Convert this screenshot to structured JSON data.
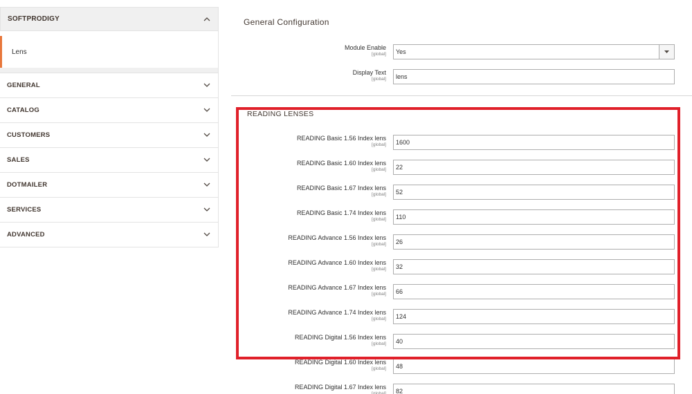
{
  "sidebar": {
    "group_title": "SOFTPRODIGY",
    "sub_item": "Lens",
    "sections": [
      "GENERAL",
      "CATALOG",
      "CUSTOMERS",
      "SALES",
      "DOTMAILER",
      "SERVICES",
      "ADVANCED"
    ]
  },
  "general": {
    "title": "General Configuration",
    "module_enable": {
      "label": "Module Enable",
      "scope": "[global]",
      "value": "Yes"
    },
    "display_text": {
      "label": "Display Text",
      "scope": "[global]",
      "value": "lens"
    }
  },
  "reading": {
    "title": "READING LENSES",
    "fields": [
      {
        "label": "READING Basic 1.56 Index lens",
        "scope": "[global]",
        "value": "1600"
      },
      {
        "label": "READING Basic 1.60 Index lens",
        "scope": "[global]",
        "value": "22"
      },
      {
        "label": "READING Basic 1.67 Index lens",
        "scope": "[global]",
        "value": "52"
      },
      {
        "label": "READING Basic 1.74 Index lens",
        "scope": "[global]",
        "value": "110"
      },
      {
        "label": "READING Advance 1.56 Index lens",
        "scope": "[global]",
        "value": "26"
      },
      {
        "label": "READING Advance 1.60 Index lens",
        "scope": "[global]",
        "value": "32"
      },
      {
        "label": "READING Advance 1.67 Index lens",
        "scope": "[global]",
        "value": "66"
      },
      {
        "label": "READING Advance 1.74 Index lens",
        "scope": "[global]",
        "value": "124"
      },
      {
        "label": "READING Digital 1.56 Index lens",
        "scope": "[global]",
        "value": "40"
      },
      {
        "label": "READING Digital 1.60 Index lens",
        "scope": "[global]",
        "value": "48"
      },
      {
        "label": "READING Digital 1.67 Index lens",
        "scope": "[global]",
        "value": "82"
      }
    ]
  },
  "colors": {
    "highlight": "#e0202a",
    "accent": "#e8773b"
  }
}
